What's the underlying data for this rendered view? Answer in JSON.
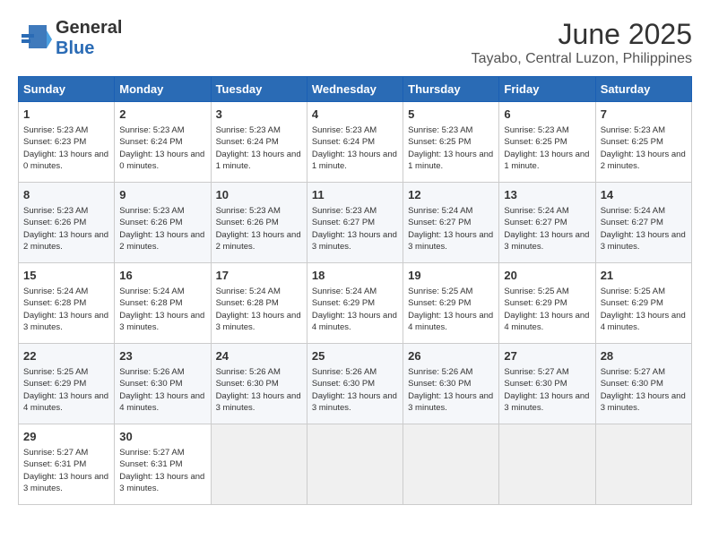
{
  "header": {
    "logo": {
      "text_general": "General",
      "text_blue": "Blue"
    },
    "title": "June 2025",
    "subtitle": "Tayabo, Central Luzon, Philippines"
  },
  "calendar": {
    "days_of_week": [
      "Sunday",
      "Monday",
      "Tuesday",
      "Wednesday",
      "Thursday",
      "Friday",
      "Saturday"
    ],
    "weeks": [
      [
        {
          "day": "1",
          "sunrise": "Sunrise: 5:23 AM",
          "sunset": "Sunset: 6:23 PM",
          "daylight": "Daylight: 13 hours and 0 minutes."
        },
        {
          "day": "2",
          "sunrise": "Sunrise: 5:23 AM",
          "sunset": "Sunset: 6:24 PM",
          "daylight": "Daylight: 13 hours and 0 minutes."
        },
        {
          "day": "3",
          "sunrise": "Sunrise: 5:23 AM",
          "sunset": "Sunset: 6:24 PM",
          "daylight": "Daylight: 13 hours and 1 minute."
        },
        {
          "day": "4",
          "sunrise": "Sunrise: 5:23 AM",
          "sunset": "Sunset: 6:24 PM",
          "daylight": "Daylight: 13 hours and 1 minute."
        },
        {
          "day": "5",
          "sunrise": "Sunrise: 5:23 AM",
          "sunset": "Sunset: 6:25 PM",
          "daylight": "Daylight: 13 hours and 1 minute."
        },
        {
          "day": "6",
          "sunrise": "Sunrise: 5:23 AM",
          "sunset": "Sunset: 6:25 PM",
          "daylight": "Daylight: 13 hours and 1 minute."
        },
        {
          "day": "7",
          "sunrise": "Sunrise: 5:23 AM",
          "sunset": "Sunset: 6:25 PM",
          "daylight": "Daylight: 13 hours and 2 minutes."
        }
      ],
      [
        {
          "day": "8",
          "sunrise": "Sunrise: 5:23 AM",
          "sunset": "Sunset: 6:26 PM",
          "daylight": "Daylight: 13 hours and 2 minutes."
        },
        {
          "day": "9",
          "sunrise": "Sunrise: 5:23 AM",
          "sunset": "Sunset: 6:26 PM",
          "daylight": "Daylight: 13 hours and 2 minutes."
        },
        {
          "day": "10",
          "sunrise": "Sunrise: 5:23 AM",
          "sunset": "Sunset: 6:26 PM",
          "daylight": "Daylight: 13 hours and 2 minutes."
        },
        {
          "day": "11",
          "sunrise": "Sunrise: 5:23 AM",
          "sunset": "Sunset: 6:27 PM",
          "daylight": "Daylight: 13 hours and 3 minutes."
        },
        {
          "day": "12",
          "sunrise": "Sunrise: 5:24 AM",
          "sunset": "Sunset: 6:27 PM",
          "daylight": "Daylight: 13 hours and 3 minutes."
        },
        {
          "day": "13",
          "sunrise": "Sunrise: 5:24 AM",
          "sunset": "Sunset: 6:27 PM",
          "daylight": "Daylight: 13 hours and 3 minutes."
        },
        {
          "day": "14",
          "sunrise": "Sunrise: 5:24 AM",
          "sunset": "Sunset: 6:27 PM",
          "daylight": "Daylight: 13 hours and 3 minutes."
        }
      ],
      [
        {
          "day": "15",
          "sunrise": "Sunrise: 5:24 AM",
          "sunset": "Sunset: 6:28 PM",
          "daylight": "Daylight: 13 hours and 3 minutes."
        },
        {
          "day": "16",
          "sunrise": "Sunrise: 5:24 AM",
          "sunset": "Sunset: 6:28 PM",
          "daylight": "Daylight: 13 hours and 3 minutes."
        },
        {
          "day": "17",
          "sunrise": "Sunrise: 5:24 AM",
          "sunset": "Sunset: 6:28 PM",
          "daylight": "Daylight: 13 hours and 3 minutes."
        },
        {
          "day": "18",
          "sunrise": "Sunrise: 5:24 AM",
          "sunset": "Sunset: 6:29 PM",
          "daylight": "Daylight: 13 hours and 4 minutes."
        },
        {
          "day": "19",
          "sunrise": "Sunrise: 5:25 AM",
          "sunset": "Sunset: 6:29 PM",
          "daylight": "Daylight: 13 hours and 4 minutes."
        },
        {
          "day": "20",
          "sunrise": "Sunrise: 5:25 AM",
          "sunset": "Sunset: 6:29 PM",
          "daylight": "Daylight: 13 hours and 4 minutes."
        },
        {
          "day": "21",
          "sunrise": "Sunrise: 5:25 AM",
          "sunset": "Sunset: 6:29 PM",
          "daylight": "Daylight: 13 hours and 4 minutes."
        }
      ],
      [
        {
          "day": "22",
          "sunrise": "Sunrise: 5:25 AM",
          "sunset": "Sunset: 6:29 PM",
          "daylight": "Daylight: 13 hours and 4 minutes."
        },
        {
          "day": "23",
          "sunrise": "Sunrise: 5:26 AM",
          "sunset": "Sunset: 6:30 PM",
          "daylight": "Daylight: 13 hours and 4 minutes."
        },
        {
          "day": "24",
          "sunrise": "Sunrise: 5:26 AM",
          "sunset": "Sunset: 6:30 PM",
          "daylight": "Daylight: 13 hours and 3 minutes."
        },
        {
          "day": "25",
          "sunrise": "Sunrise: 5:26 AM",
          "sunset": "Sunset: 6:30 PM",
          "daylight": "Daylight: 13 hours and 3 minutes."
        },
        {
          "day": "26",
          "sunrise": "Sunrise: 5:26 AM",
          "sunset": "Sunset: 6:30 PM",
          "daylight": "Daylight: 13 hours and 3 minutes."
        },
        {
          "day": "27",
          "sunrise": "Sunrise: 5:27 AM",
          "sunset": "Sunset: 6:30 PM",
          "daylight": "Daylight: 13 hours and 3 minutes."
        },
        {
          "day": "28",
          "sunrise": "Sunrise: 5:27 AM",
          "sunset": "Sunset: 6:30 PM",
          "daylight": "Daylight: 13 hours and 3 minutes."
        }
      ],
      [
        {
          "day": "29",
          "sunrise": "Sunrise: 5:27 AM",
          "sunset": "Sunset: 6:31 PM",
          "daylight": "Daylight: 13 hours and 3 minutes."
        },
        {
          "day": "30",
          "sunrise": "Sunrise: 5:27 AM",
          "sunset": "Sunset: 6:31 PM",
          "daylight": "Daylight: 13 hours and 3 minutes."
        },
        null,
        null,
        null,
        null,
        null
      ]
    ]
  }
}
